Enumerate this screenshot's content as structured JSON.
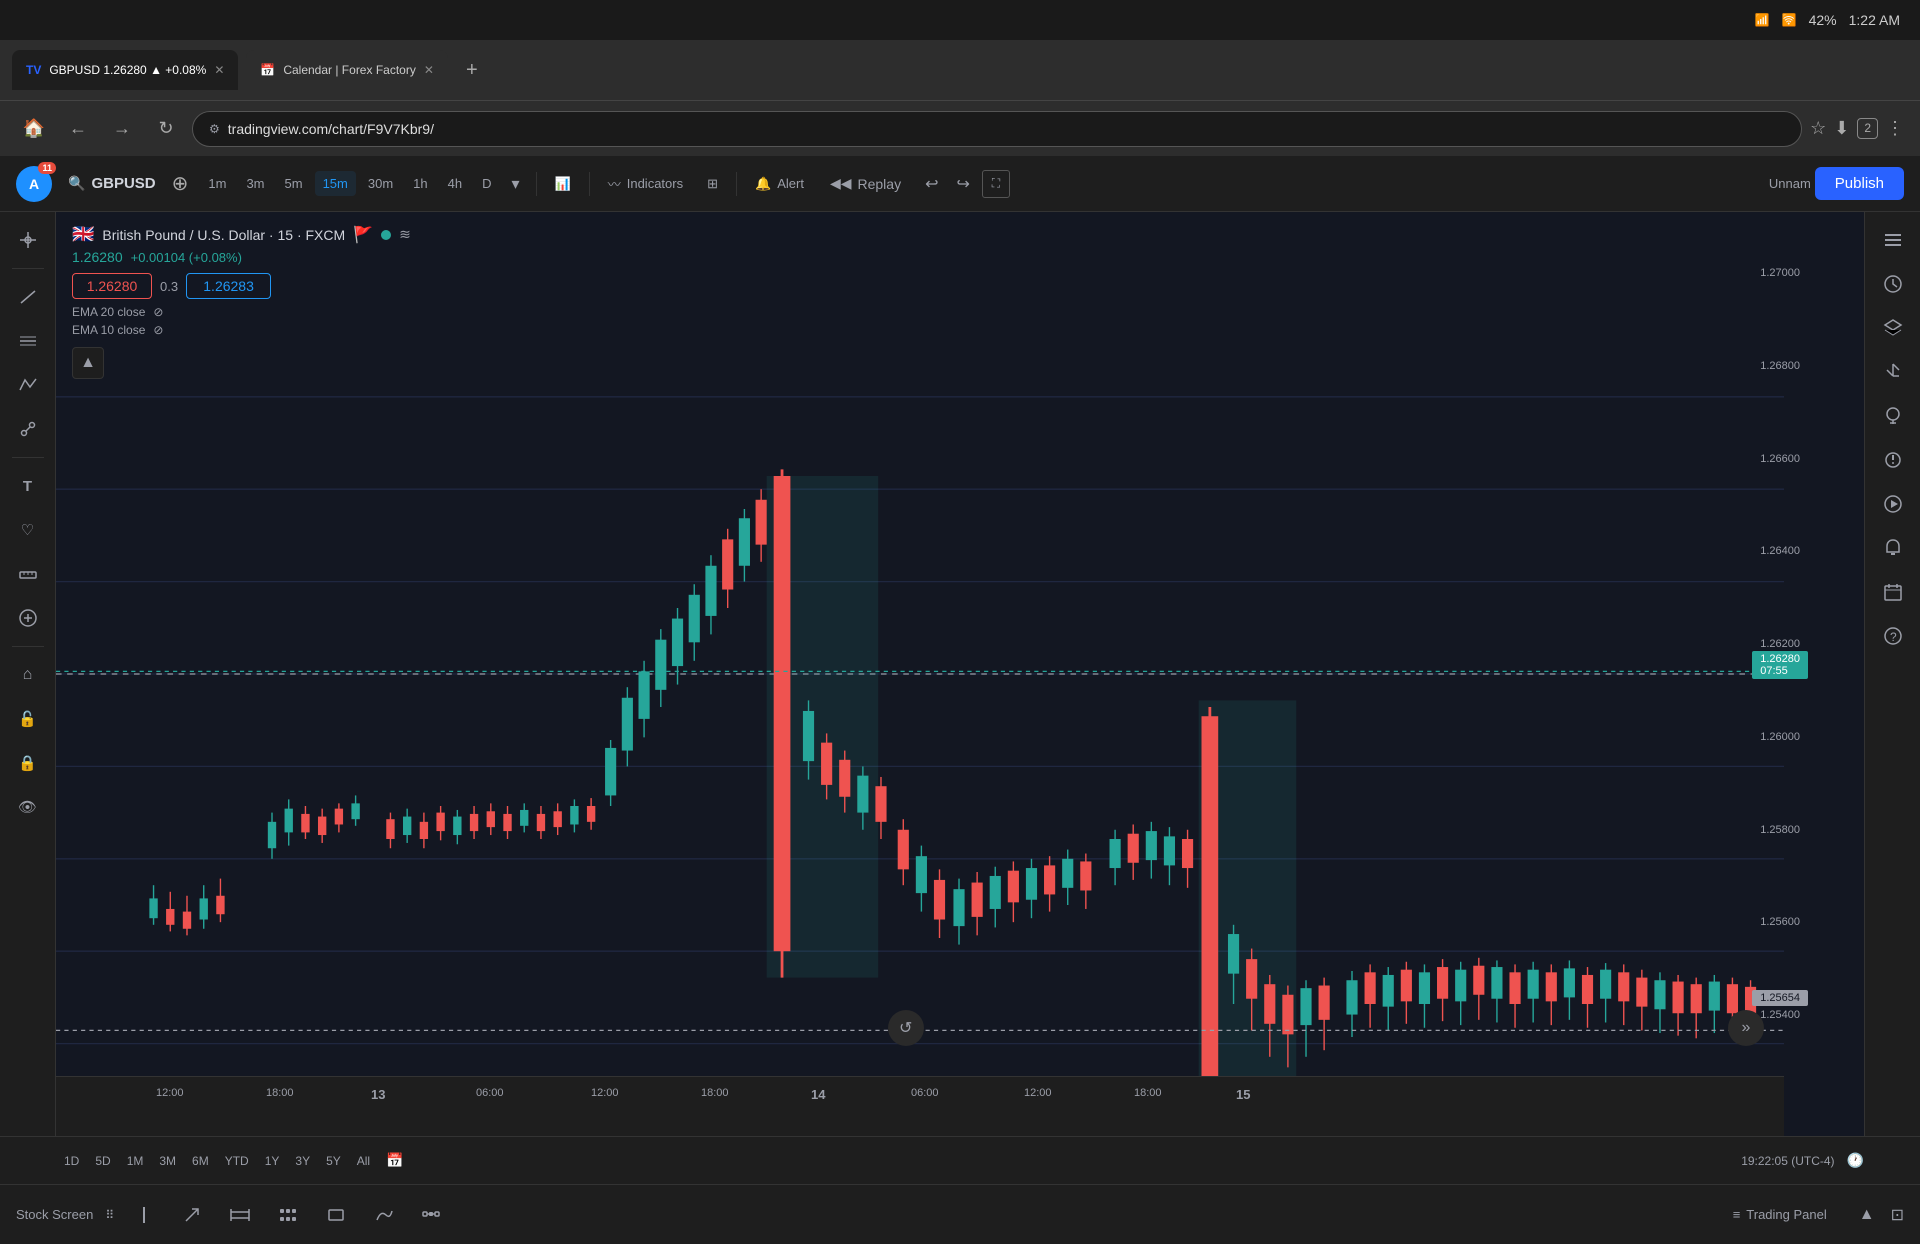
{
  "statusBar": {
    "time": "1:22 AM",
    "battery": "42%",
    "signal": "●●●●"
  },
  "browser": {
    "tab1": {
      "label": "GBPUSD 1.26280 ▲ +0.08%",
      "url": "tradingview.com/chart/F9V7Kbr9/"
    },
    "tab2": {
      "label": "Calendar | Forex Factory"
    }
  },
  "toolbar": {
    "symbol": "GBPUSD",
    "timeframes": [
      "1m",
      "3m",
      "5m",
      "15m",
      "30m",
      "1h",
      "4h",
      "D"
    ],
    "active_timeframe": "15m",
    "indicators_label": "Indicators",
    "alert_label": "Alert",
    "replay_label": "Replay",
    "publish_label": "Publish",
    "unnam_label": "Unnam"
  },
  "chart": {
    "pair": "British Pound / U.S. Dollar · 15 · FXCM",
    "price": "1.26280",
    "change": "+0.00104 (+0.08%)",
    "input_price1": "1.26280",
    "input_step": "0.3",
    "input_price2": "1.26283",
    "ema1": "EMA 20 close",
    "ema2": "EMA 10 close",
    "price_scale": {
      "levels": [
        "1.27000",
        "1.26800",
        "1.26600",
        "1.26400",
        "1.26200",
        "1.26000",
        "1.25800",
        "1.25600",
        "1.25400"
      ]
    },
    "current_price_label": "1.26280",
    "current_time_label": "07:55",
    "last_price_label": "1.25654",
    "horizontal_line": "1.25600"
  },
  "timeAxis": {
    "labels": [
      "12:00",
      "18:00",
      "13",
      "06:00",
      "12:00",
      "18:00",
      "14",
      "06:00",
      "12:00",
      "18:00",
      "15"
    ],
    "time_display": "19:22:05 (UTC-4)"
  },
  "timeRangeButtons": {
    "items": [
      "1D",
      "5D",
      "1M",
      "3M",
      "6M",
      "YTD",
      "1Y",
      "3Y",
      "5Y",
      "All"
    ]
  },
  "bottomBar": {
    "label": "Stock Screen",
    "trading_panel": "Trading Panel",
    "tools": [
      "line",
      "poly",
      "brush",
      "rect",
      "curve",
      "segment"
    ]
  },
  "priceScaleRight": {
    "items": [
      "list-icon",
      "clock-icon",
      "layers-icon",
      "flame-icon",
      "target-icon",
      "broadcast-icon",
      "arrow-right-icon",
      "bell-icon",
      "calendar-icon",
      "help-icon"
    ]
  },
  "leftTools": [
    "crosshair-tool",
    "line-tool",
    "horizontal-line-tool",
    "ray-tool",
    "node-tool",
    "text-tool",
    "heart-tool",
    "ruler-tool",
    "add-tool",
    "home-tool",
    "lock-open-tool",
    "lock-tool",
    "eye-tool"
  ]
}
